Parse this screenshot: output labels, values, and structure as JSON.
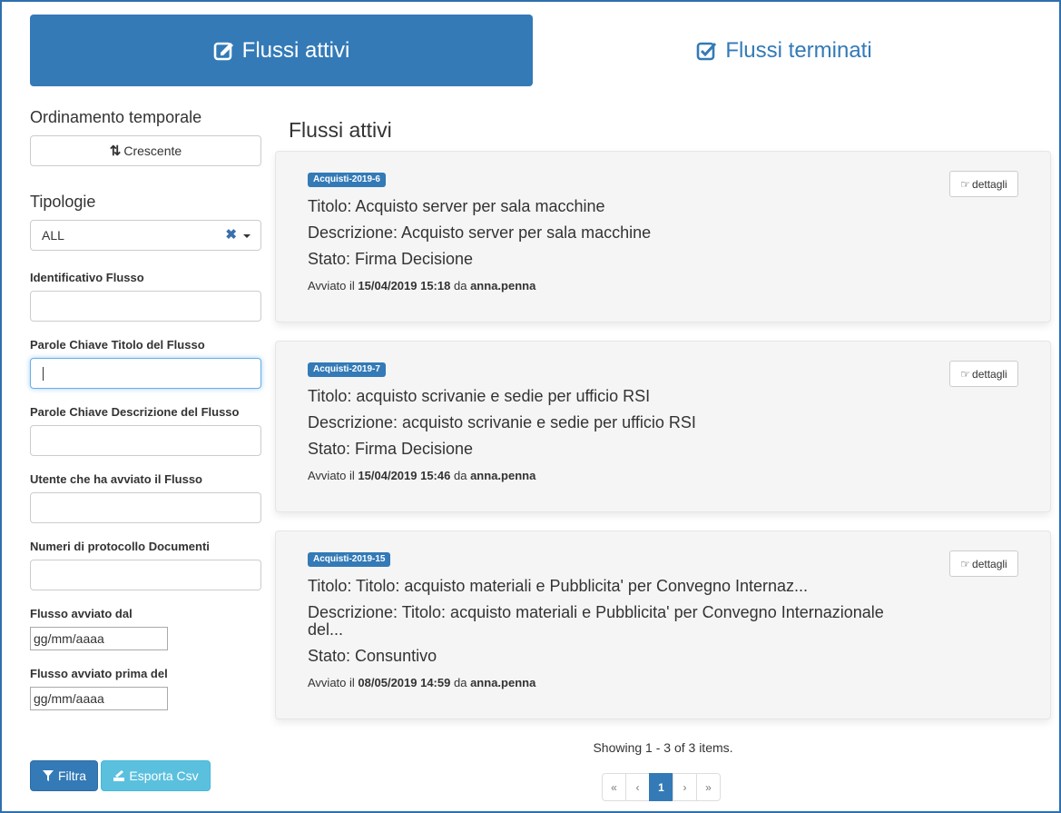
{
  "tabs": {
    "active_label": "Flussi attivi",
    "inactive_label": "Flussi terminati"
  },
  "sidebar": {
    "sort_label": "Ordinamento temporale",
    "sort_button": "Crescente",
    "types_label": "Tipologie",
    "types_value": "ALL",
    "fields": {
      "id_label": "Identificativo Flusso",
      "title_kw_label": "Parole Chiave Titolo del Flusso",
      "desc_kw_label": "Parole Chiave Descrizione del Flusso",
      "user_label": "Utente che ha avviato il Flusso",
      "protocol_label": "Numeri di protocollo Documenti",
      "from_label": "Flusso avviato dal",
      "from_value": "gg/mm/aaaa",
      "before_label": "Flusso avviato prima del",
      "before_value": "gg/mm/aaaa"
    },
    "filter_button": "Filtra",
    "export_button": "Esporta Csv"
  },
  "main": {
    "title": "Flussi attivi",
    "details_label": "dettagli",
    "cards": [
      {
        "badge": "Acquisti-2019-6",
        "title": "Titolo: Acquisto server per sala macchine",
        "description": "Descrizione: Acquisto server per sala macchine",
        "state": "Stato: Firma Decisione",
        "started_prefix": "Avviato il",
        "started_date": "15/04/2019 15:18",
        "by": "da",
        "user": "anna.penna"
      },
      {
        "badge": "Acquisti-2019-7",
        "title": "Titolo: acquisto scrivanie e sedie per ufficio RSI",
        "description": "Descrizione: acquisto scrivanie e sedie per ufficio RSI",
        "state": "Stato: Firma Decisione",
        "started_prefix": "Avviato il",
        "started_date": "15/04/2019 15:46",
        "by": "da",
        "user": "anna.penna"
      },
      {
        "badge": "Acquisti-2019-15",
        "title": "Titolo: Titolo: acquisto materiali e Pubblicita' per Convegno Internaz...",
        "description_line1": "Descrizione: Titolo: acquisto materiali e Pubblicita' per Convegno Internazionale",
        "description_line2": "del...",
        "state": "Stato: Consuntivo",
        "started_prefix": "Avviato il",
        "started_date": "08/05/2019 14:59",
        "by": "da",
        "user": "anna.penna"
      }
    ],
    "showing": "Showing 1 - 3 of 3 items.",
    "pager": {
      "first": "«",
      "prev": "‹",
      "current": "1",
      "next": "›",
      "last": "»"
    }
  },
  "colors": {
    "primary": "#337ab7",
    "info": "#5bc0de",
    "card_bg": "#f5f5f5"
  }
}
